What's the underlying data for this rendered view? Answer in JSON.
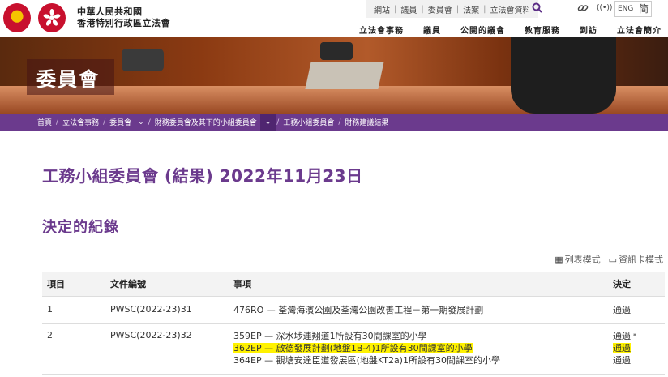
{
  "header": {
    "org_name_line1": "中華人民共和國",
    "org_name_line2": "香港特別行政區立法會",
    "utility_links": [
      "網站",
      "議員",
      "委員會",
      "法案",
      "立法會資料"
    ],
    "lang_en": "ENG",
    "lang_sc": "简",
    "main_nav": [
      "立法會事務",
      "議員",
      "公開的議會",
      "教育服務",
      "到訪",
      "立法會簡介"
    ]
  },
  "banner": {
    "title": "委員會"
  },
  "breadcrumb": [
    "首頁",
    "立法會事務",
    "委員會",
    "財務委員會及其下的小組委員會",
    "工務小組委員會",
    "財務建議結果"
  ],
  "page_title": "工務小組委員會 (結果) 2022年11月23日",
  "section_title": "決定的紀錄",
  "view_modes": {
    "list": "列表模式",
    "card": "資訊卡模式"
  },
  "table": {
    "headers": {
      "no": "項目",
      "doc": "文件編號",
      "item": "事項",
      "decision": "決定"
    },
    "rows": [
      {
        "no": "1",
        "doc": "PWSC(2022-23)31",
        "items": [
          "476RO — 荃灣海濱公園及荃灣公園改善工程－第一期發展計劃"
        ],
        "decisions": [
          "通過"
        ]
      },
      {
        "no": "2",
        "doc": "PWSC(2022-23)32",
        "items": [
          "359EP — 深水埗連翔道1所設有30間課室的小學",
          "362EP — 啟德發展計劃(地盤1B-4)1所設有30間課室的小學",
          "364EP — 觀塘安達臣道發展區(地盤KT2a)1所設有30間課室的小學"
        ],
        "decisions": [
          "通過",
          "通過",
          "通過"
        ],
        "decision_note": "*"
      }
    ]
  },
  "colors": {
    "brand_purple": "#6b3a8d",
    "highlight": "#fff200",
    "link": "#4a6b99"
  }
}
